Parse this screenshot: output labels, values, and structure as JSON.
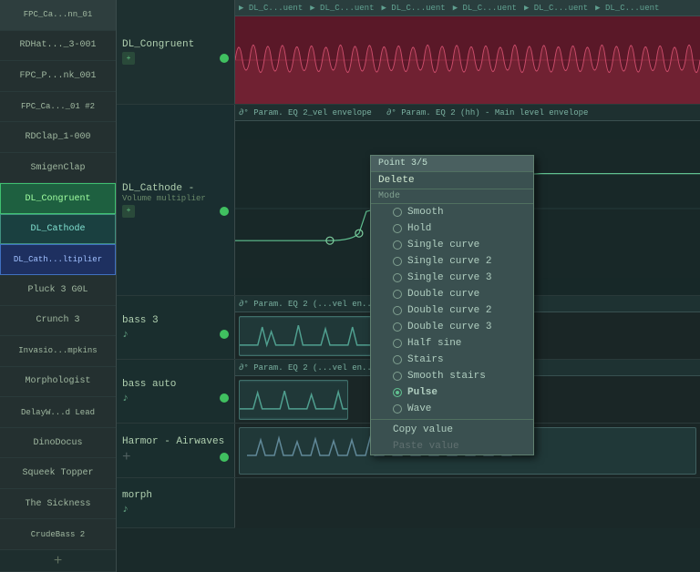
{
  "tracks": {
    "sidebar_items": [
      {
        "label": "FPC_Ca...nn_01",
        "style": "default"
      },
      {
        "label": "RDHat..._3-001",
        "style": "default"
      },
      {
        "label": "FPC_P...nk_001",
        "style": "default"
      },
      {
        "label": "FPC_Ca..._01 #2",
        "style": "default"
      },
      {
        "label": "RDClap_1-000",
        "style": "default"
      },
      {
        "label": "SmigenClap",
        "style": "default"
      },
      {
        "label": "DL_Congruent",
        "style": "active_green"
      },
      {
        "label": "DL_Cathode",
        "style": "active_teal"
      },
      {
        "label": "DL_Cath...ltiplier",
        "style": "active_blue"
      },
      {
        "label": "Pluck 3 G0L",
        "style": "default"
      },
      {
        "label": "Crunch 3",
        "style": "default"
      },
      {
        "label": "Invasio...mpkins",
        "style": "default"
      },
      {
        "label": "Morphologist",
        "style": "default"
      },
      {
        "label": "DelayW...d Lead",
        "style": "default"
      },
      {
        "label": "DinoDocus",
        "style": "default"
      },
      {
        "label": "Squeek Topper",
        "style": "default"
      },
      {
        "label": "The Sickness",
        "style": "default"
      },
      {
        "label": "CrudeBass 2",
        "style": "default"
      }
    ],
    "add_button": "+"
  },
  "track_rows": [
    {
      "id": "dl-congruent",
      "label": "DL_Congruent",
      "header_segments": [
        "▶ DL_C...uent",
        "▶ DL_C...uent",
        "▶ DL_C...uent",
        "▶ DL_C...uent",
        "▶ DL_C...uent",
        "▶ DL_C...uent"
      ]
    },
    {
      "id": "dl-cathode",
      "label": "DL_Cathode -",
      "sublabel": "Volume multiplier",
      "header_text": "∂° Param. EQ 2_vel envelope  ∂° Param. EQ 2 (hh) - Main level envelope"
    },
    {
      "id": "bass-3",
      "label": "bass 3",
      "header_text": "∂° Param. EQ 2 (...vel en..."
    },
    {
      "id": "bass-auto",
      "label": "bass auto",
      "header_text": "∂° Param. EQ 2 (...vel en..."
    },
    {
      "id": "harmor",
      "label": "Harmor - Airwaves"
    },
    {
      "id": "morph",
      "label": "morph"
    }
  ],
  "context_menu": {
    "title": "Point 3/5",
    "delete": "Delete",
    "mode_section": "Mode",
    "items": [
      {
        "label": "Smooth",
        "radio": false
      },
      {
        "label": "Hold",
        "radio": false
      },
      {
        "label": "Single curve",
        "radio": false
      },
      {
        "label": "Single curve 2",
        "radio": false
      },
      {
        "label": "Single curve 3",
        "radio": false
      },
      {
        "label": "Double curve",
        "radio": false
      },
      {
        "label": "Double curve 2",
        "radio": false
      },
      {
        "label": "Double curve 3",
        "radio": false
      },
      {
        "label": "Half sine",
        "radio": false
      },
      {
        "label": "Stairs",
        "radio": false
      },
      {
        "label": "Smooth stairs",
        "radio": false
      },
      {
        "label": "Pulse",
        "radio": true
      },
      {
        "label": "Wave",
        "radio": false
      }
    ],
    "copy_value": "Copy value",
    "paste_value": "Paste value"
  }
}
